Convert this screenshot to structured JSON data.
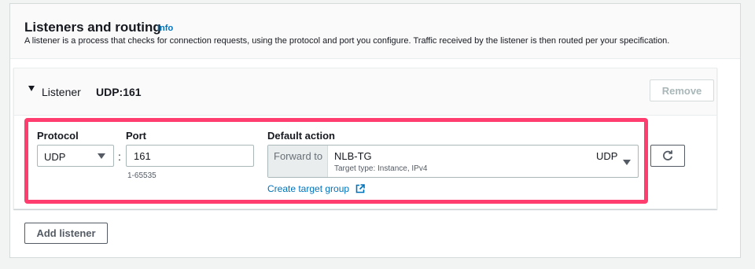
{
  "section": {
    "title": "Listeners and routing",
    "info_link": "Info",
    "description": "A listener is a process that checks for connection requests, using the protocol and port you configure. Traffic received by the listener is then routed per your specification."
  },
  "listener": {
    "label": "Listener",
    "value": "UDP:161",
    "remove_label": "Remove",
    "protocol": {
      "label": "Protocol",
      "value": "UDP"
    },
    "port": {
      "label": "Port",
      "value": "161",
      "hint": "1-65535"
    },
    "default_action": {
      "label": "Default action",
      "prefix": "Forward to",
      "target_name": "NLB-TG",
      "target_subtitle": "Target type: Instance, IPv4",
      "target_protocol": "UDP",
      "create_link": "Create target group"
    }
  },
  "add_listener_label": "Add listener",
  "colors": {
    "link": "#0073bb",
    "highlight": "#ff3d6e",
    "border": "#aab7b8"
  },
  "icons": [
    "caret-down-icon",
    "dropdown-arrow-icon",
    "external-link-icon",
    "refresh-icon"
  ]
}
